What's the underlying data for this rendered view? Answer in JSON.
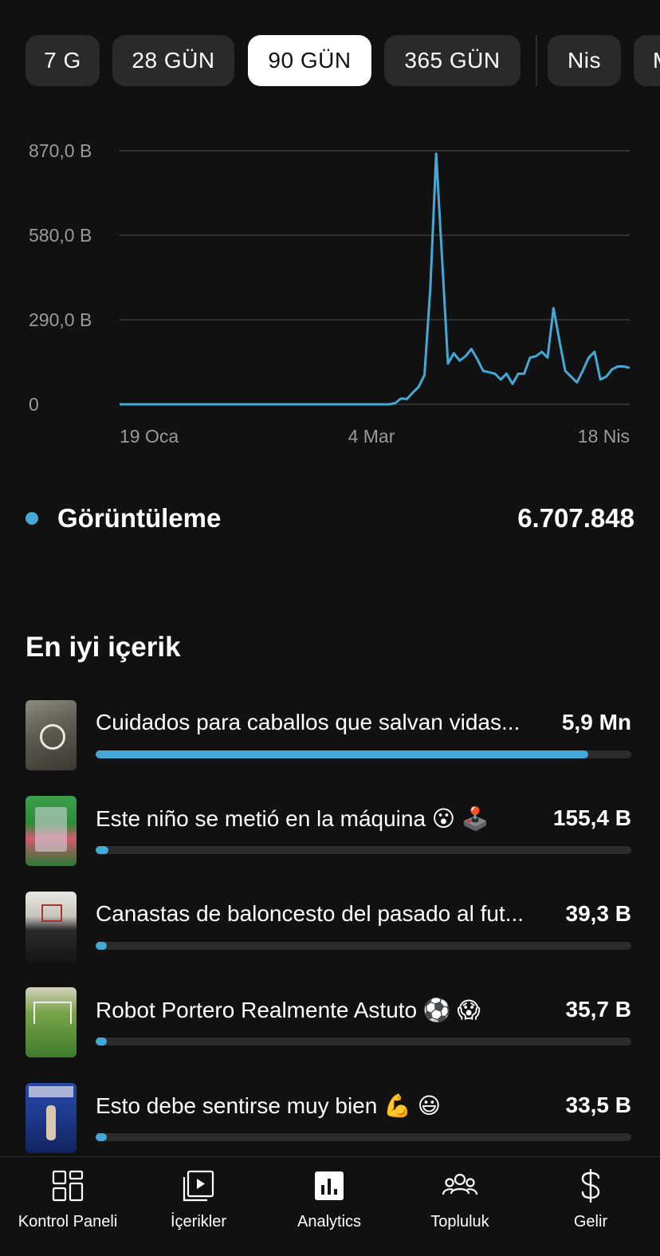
{
  "range_chips": {
    "items": [
      {
        "label": "7 G",
        "active": false
      },
      {
        "label": "28 GÜN",
        "active": false
      },
      {
        "label": "90 GÜN",
        "active": true
      },
      {
        "label": "365 GÜN",
        "active": false
      },
      {
        "label": "Nis",
        "active": false
      },
      {
        "label": "M",
        "active": false
      }
    ]
  },
  "chart_data": {
    "type": "line",
    "y_ticks": [
      "870,0 B",
      "580,0 B",
      "290,0 B",
      "0"
    ],
    "y_tick_values": [
      870000,
      580000,
      290000,
      0
    ],
    "ylim": [
      0,
      870000
    ],
    "x_ticks": [
      "19 Oca",
      "4 Mar",
      "18 Nis"
    ],
    "grid": true,
    "color": "#44a9d6",
    "series": [
      {
        "values": [
          0,
          0,
          0,
          0,
          0,
          0,
          0,
          0,
          0,
          0,
          0,
          0,
          0,
          0,
          0,
          0,
          0,
          0,
          0,
          0,
          0,
          0,
          0,
          0,
          0,
          0,
          0,
          0,
          0,
          0,
          0,
          0,
          0,
          0,
          0,
          0,
          0,
          0,
          0,
          0,
          0,
          0,
          0,
          0,
          0,
          0,
          0,
          4000,
          20000,
          18000,
          40000,
          60000,
          100000,
          400000,
          860000,
          500000,
          140000,
          175000,
          150000,
          165000,
          190000,
          155000,
          115000,
          110000,
          105000,
          85000,
          105000,
          70000,
          105000,
          105000,
          160000,
          165000,
          180000,
          160000,
          330000,
          220000,
          115000,
          95000,
          75000,
          115000,
          160000,
          180000,
          85000,
          95000,
          120000,
          130000,
          130000,
          125000
        ]
      }
    ]
  },
  "metric": {
    "label": "Görüntüleme",
    "value": "6.707.848",
    "color": "#44a9d6"
  },
  "top_content": {
    "title": "En iyi içerik",
    "items": [
      {
        "title": "Cuidados para caballos que salvan vidas...",
        "value": "5,9 Mn",
        "progress": 0.92
      },
      {
        "title": "Este niño se metió en la máquina 😮 🕹️",
        "value": "155,4 B",
        "progress": 0.024
      },
      {
        "title": "Canastas de baloncesto del pasado al fut...",
        "value": "39,3 B",
        "progress": 0.007
      },
      {
        "title": "Robot Portero Realmente Astuto ⚽ 😱",
        "value": "35,7 B",
        "progress": 0.006
      },
      {
        "title": "Esto debe sentirse muy bien 💪 😃",
        "value": "33,5 B",
        "progress": 0.006
      }
    ]
  },
  "bottom_nav": {
    "items": [
      {
        "label": "Kontrol Paneli",
        "icon": "dashboard-icon"
      },
      {
        "label": "İçerikler",
        "icon": "content-icon"
      },
      {
        "label": "Analytics",
        "icon": "analytics-icon",
        "active": true
      },
      {
        "label": "Topluluk",
        "icon": "community-icon"
      },
      {
        "label": "Gelir",
        "icon": "dollar-icon"
      }
    ]
  }
}
